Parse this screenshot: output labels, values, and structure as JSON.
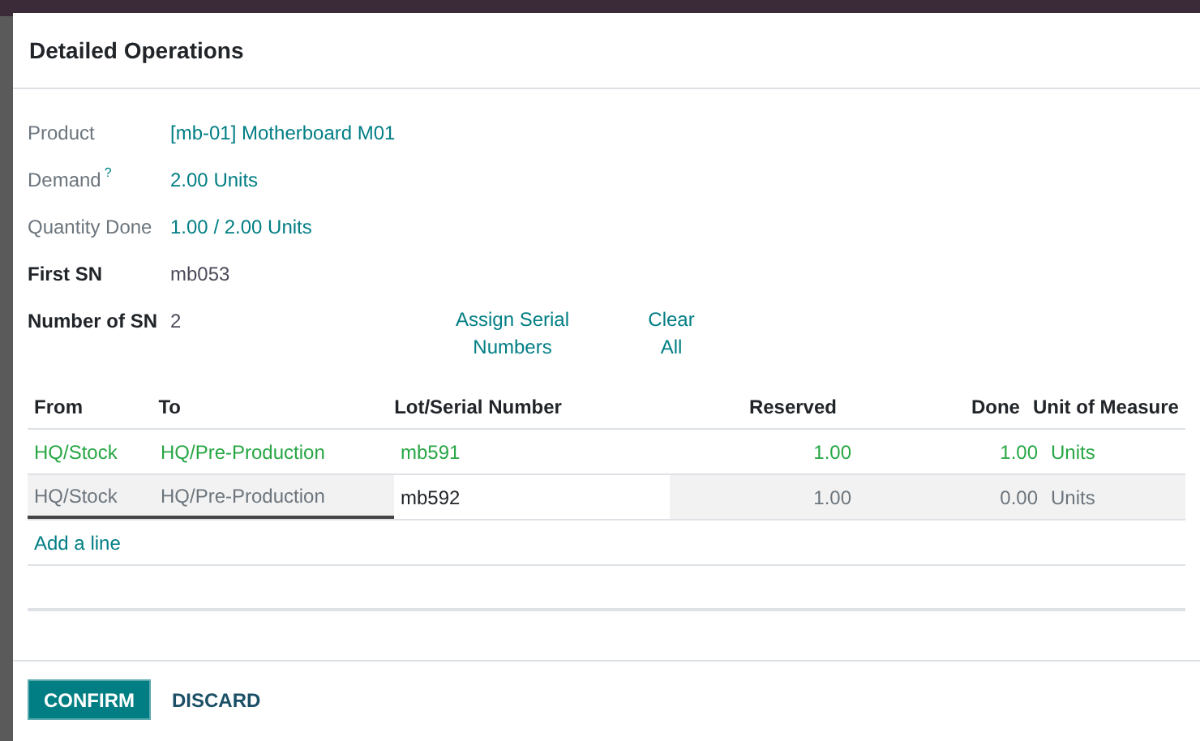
{
  "dialog": {
    "title": "Detailed Operations",
    "fields": [
      {
        "label": "Product",
        "required": false,
        "value": "[mb-01] Motherboard M01"
      },
      {
        "label": "Demand",
        "help": "?",
        "required": false,
        "value": "2.00 Units"
      },
      {
        "label": "Quantity Done",
        "required": false,
        "value": "1.00 / 2.00 Units"
      },
      {
        "label": "First SN",
        "required": true,
        "value": "mb053"
      },
      {
        "label": "Number of SN",
        "required": true,
        "value": "2"
      }
    ],
    "actions": [
      "Assign Serial Numbers",
      "Clear All"
    ],
    "table": {
      "columns": [
        "From",
        "To",
        "Lot/Serial Number",
        "Reserved",
        "Done",
        "Unit of Measure"
      ],
      "rows": [
        {
          "editing": false,
          "cells": [
            "HQ/Stock",
            "HQ/Pre-Production",
            "mb591",
            "1.00",
            "1.00",
            "Units"
          ]
        },
        {
          "editing": true,
          "cells": [
            "HQ/Stock",
            "HQ/Pre-Production",
            "mb592",
            "1.00",
            "0.00",
            "Units"
          ]
        }
      ],
      "add_line": "Add a line"
    },
    "buttons": [
      "CONFIRM",
      "DISCARD"
    ]
  }
}
